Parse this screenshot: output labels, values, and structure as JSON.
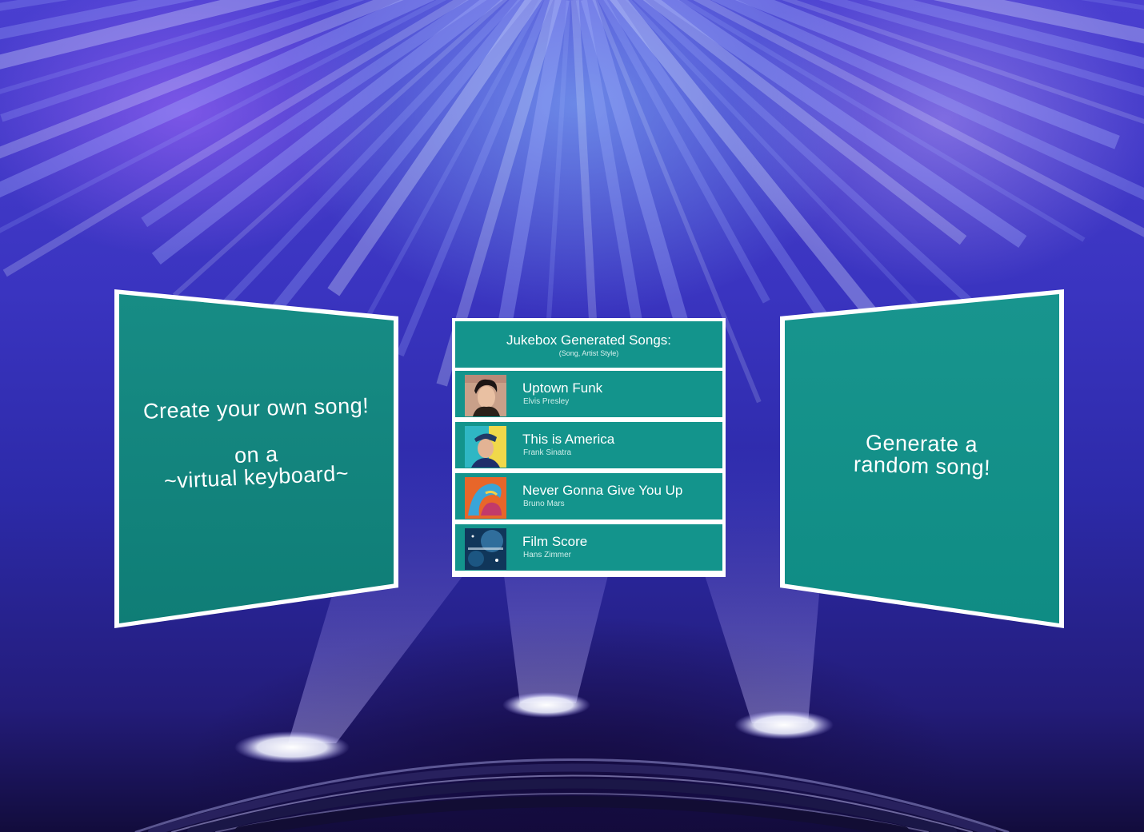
{
  "left_panel": {
    "line1": "Create your own song!",
    "line2": "on a",
    "line3": "~virtual keyboard~"
  },
  "right_panel": {
    "line1": "Generate a",
    "line2": "random song!"
  },
  "song_list": {
    "title": "Jukebox Generated Songs:",
    "subtitle": "(Song, Artist Style)",
    "songs": [
      {
        "title": "Uptown Funk",
        "artist": "Elvis Presley"
      },
      {
        "title": "This is America",
        "artist": "Frank Sinatra"
      },
      {
        "title": "Never Gonna Give You Up",
        "artist": "Bruno Mars"
      },
      {
        "title": "Film Score",
        "artist": "Hans Zimmer"
      }
    ]
  },
  "colors": {
    "panel_teal": "#13948c",
    "panel_border": "#ffffff",
    "background_purple": "#3a34c0"
  }
}
